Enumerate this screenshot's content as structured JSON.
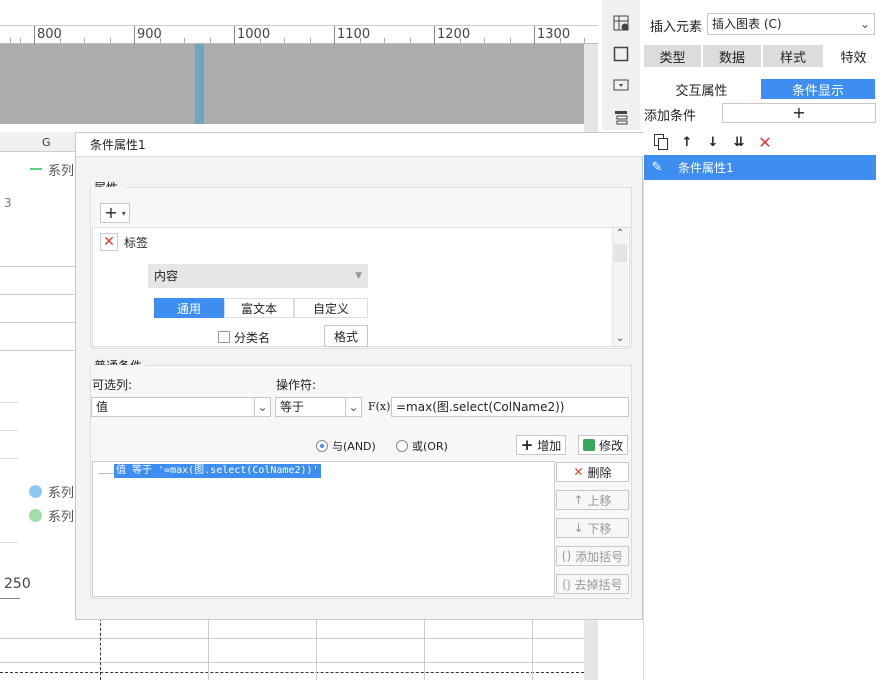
{
  "ruler": {
    "ticks": [
      "800",
      "900",
      "1000",
      "1100",
      "1200",
      "1300"
    ]
  },
  "left_bg": {
    "col_g": "G",
    "legend_top": "系列",
    "side_num": "3",
    "legend_a": "系列",
    "legend_b": "系列",
    "axis_val": "250",
    "colors": {
      "series_line": "#5ecf88",
      "legend_a": "#8ec8f2",
      "legend_b": "#9ee0a8"
    }
  },
  "right_panel": {
    "insert_label": "插入元素",
    "insert_select": "插入图表 (C)",
    "tabs": [
      "类型",
      "数据",
      "样式",
      "特效"
    ],
    "subtabs": [
      "交互属性",
      "条件显示"
    ],
    "add_condition_label": "添加条件",
    "list_item": "条件属性1",
    "icons": [
      "cell-icon",
      "frame-icon",
      "dropdown-widget-icon",
      "list-widget-icon"
    ]
  },
  "dialog": {
    "title": "条件属性1",
    "props_group_label": "属性",
    "prop_label": "标签",
    "content_select": "内容",
    "format_tabs": [
      "通用",
      "富文本",
      "自定义"
    ],
    "checkbox_label": "分类名",
    "format_button": "格式",
    "cond_group_label": "普通条件",
    "column_label": "可选列:",
    "operator_label": "操作符:",
    "column_value": "值",
    "operator_value": "等于",
    "fx_label": "F(x)",
    "formula_value": "=max(图.select(ColName2))",
    "radio_and": "与(AND)",
    "radio_or": "或(OR)",
    "add_button": "增加",
    "edit_button": "修改",
    "condition_item": "值 等于 '=max(图.select(ColName2))'",
    "side_buttons": [
      "删除",
      "上移",
      "下移",
      "添加括号",
      "去掉括号"
    ]
  },
  "accent": "#3d8ef0"
}
